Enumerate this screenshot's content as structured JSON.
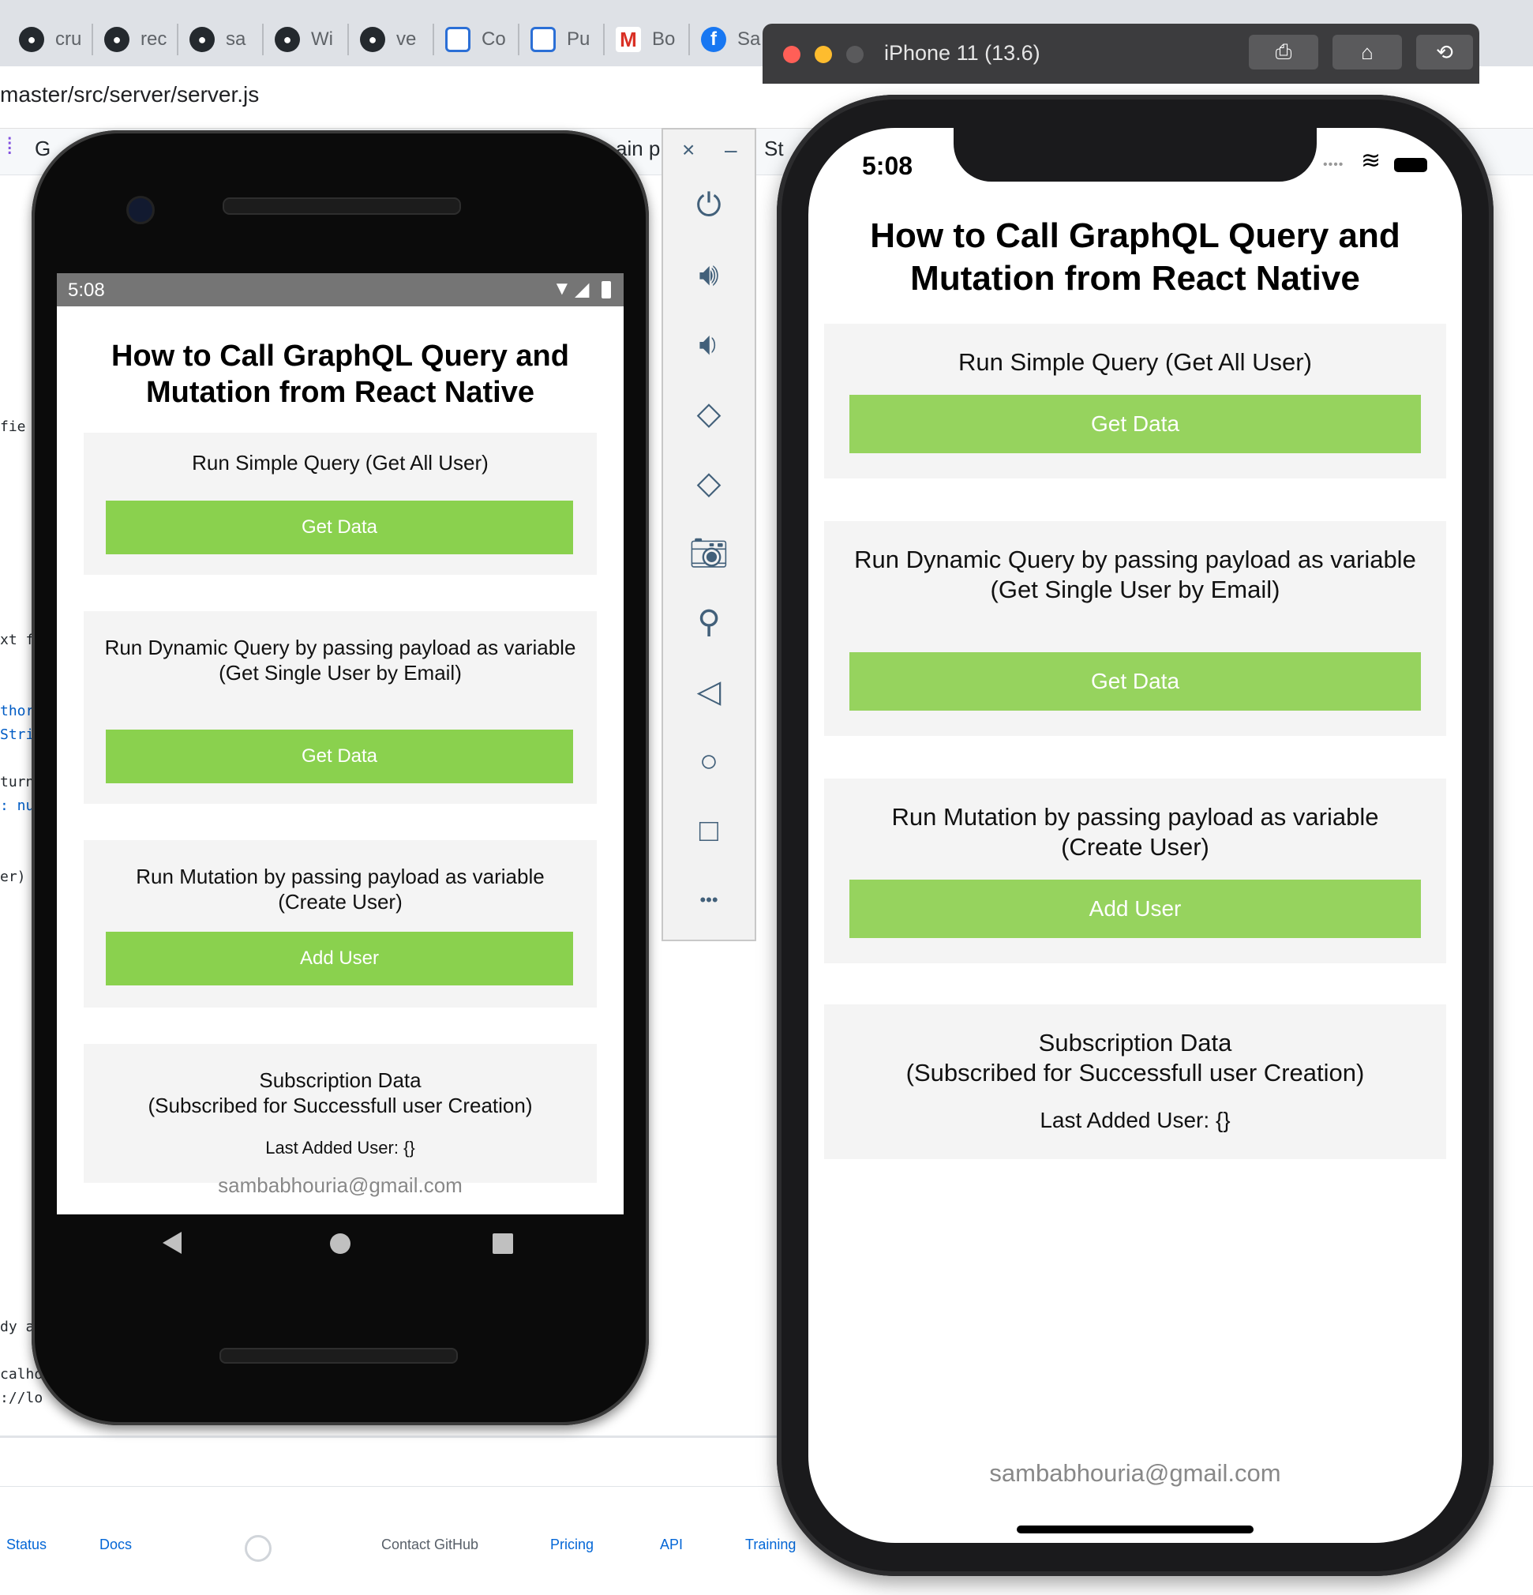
{
  "browser": {
    "tabs": [
      {
        "label": "cru",
        "icon": "github-icon"
      },
      {
        "label": "rec",
        "icon": "github-icon"
      },
      {
        "label": "sa",
        "icon": "github-icon"
      },
      {
        "label": "Wi",
        "icon": "github-icon"
      },
      {
        "label": "ve",
        "icon": "github-icon"
      },
      {
        "label": "Co",
        "icon": "vscode-icon"
      },
      {
        "label": "Pu",
        "icon": "vscode-icon"
      },
      {
        "label": "Bo",
        "icon": "gmail-icon"
      },
      {
        "label": "Sa",
        "icon": "facebook-icon"
      }
    ],
    "address": "master/src/server/server.js",
    "strip_left": "G",
    "strip_mid": "ain p",
    "strip_right": "St",
    "code_fragments": [
      "fie",
      "xt f",
      "thor",
      "Stri",
      "turn",
      ": nu",
      "er)",
      "dy a",
      "calho",
      "://lo"
    ],
    "footer_links": [
      "Status",
      "Docs",
      "Contact GitHub",
      "Pricing",
      "API",
      "Training"
    ]
  },
  "android": {
    "status_time": "5:08",
    "title": "How to Call GraphQL Query and Mutation from React Native",
    "sections": [
      {
        "label": "Run Simple Query (Get All User)",
        "button": "Get Data"
      },
      {
        "label": "Run Dynamic Query by passing payload as variable\n(Get Single User by Email)",
        "button": "Get Data"
      },
      {
        "label": "Run Mutation by passing payload as variable\n(Create User)",
        "button": "Add User"
      },
      {
        "label": "Subscription Data\n(Subscribed for Successfull user Creation)",
        "sub": "Last Added User: {}"
      }
    ],
    "footer_email": "sambabhouria@gmail.com"
  },
  "emulator_toolbar": {
    "close": "×",
    "minimize": "–",
    "more": "•••"
  },
  "ios": {
    "window_title": "iPhone 11 (13.6)",
    "status_time": "5:08",
    "title": "How to Call GraphQL Query and Mutation from React Native",
    "sections": [
      {
        "label": "Run Simple Query (Get All User)",
        "button": "Get Data"
      },
      {
        "label": "Run Dynamic Query by passing payload as variable\n(Get Single User by Email)",
        "button": "Get Data"
      },
      {
        "label": "Run Mutation by passing payload as variable\n(Create User)",
        "button": "Add User"
      },
      {
        "label": "Subscription Data\n(Subscribed for Successfull user Creation)",
        "sub": "Last Added User: {}"
      }
    ],
    "footer_email": "sambabhouria@gmail.com"
  },
  "colors": {
    "android_button": "#8ad14e",
    "ios_button": "#96d35e",
    "card_bg": "#f4f4f4"
  }
}
